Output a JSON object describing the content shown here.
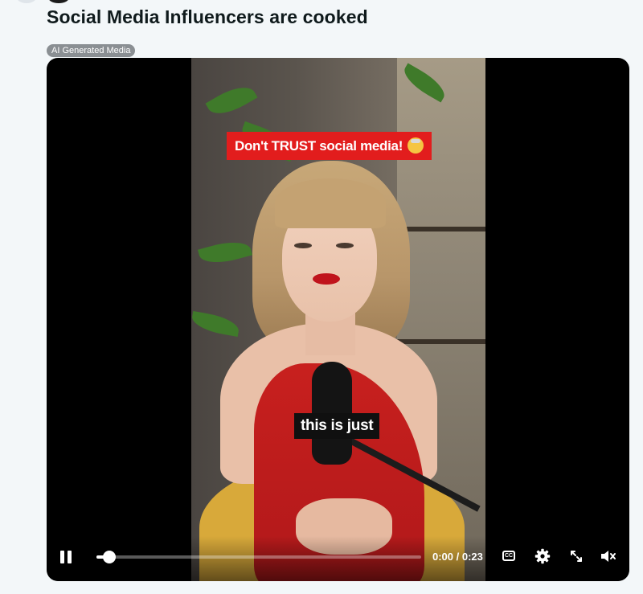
{
  "post": {
    "title": "Social Media Influencers are cooked",
    "flair": "AI Generated Media"
  },
  "video": {
    "caption_top": "Don't TRUST social media!",
    "caption_emoji": "exploding-head-emoji",
    "caption_subtitle": "this is just"
  },
  "controls": {
    "time_display": "0:00 / 0:23",
    "progress": 0.04,
    "cc_label": "CC",
    "icons": {
      "play_pause": "pause-icon",
      "captions": "closed-captions-icon",
      "settings": "gear-icon",
      "fullscreen": "expand-icon",
      "volume": "muted-speaker-icon"
    }
  },
  "colors": {
    "page_background": "#f3f7f9",
    "flair_background": "#8a8f93",
    "caption_red": "#e21d1d",
    "player_background": "#000000"
  }
}
